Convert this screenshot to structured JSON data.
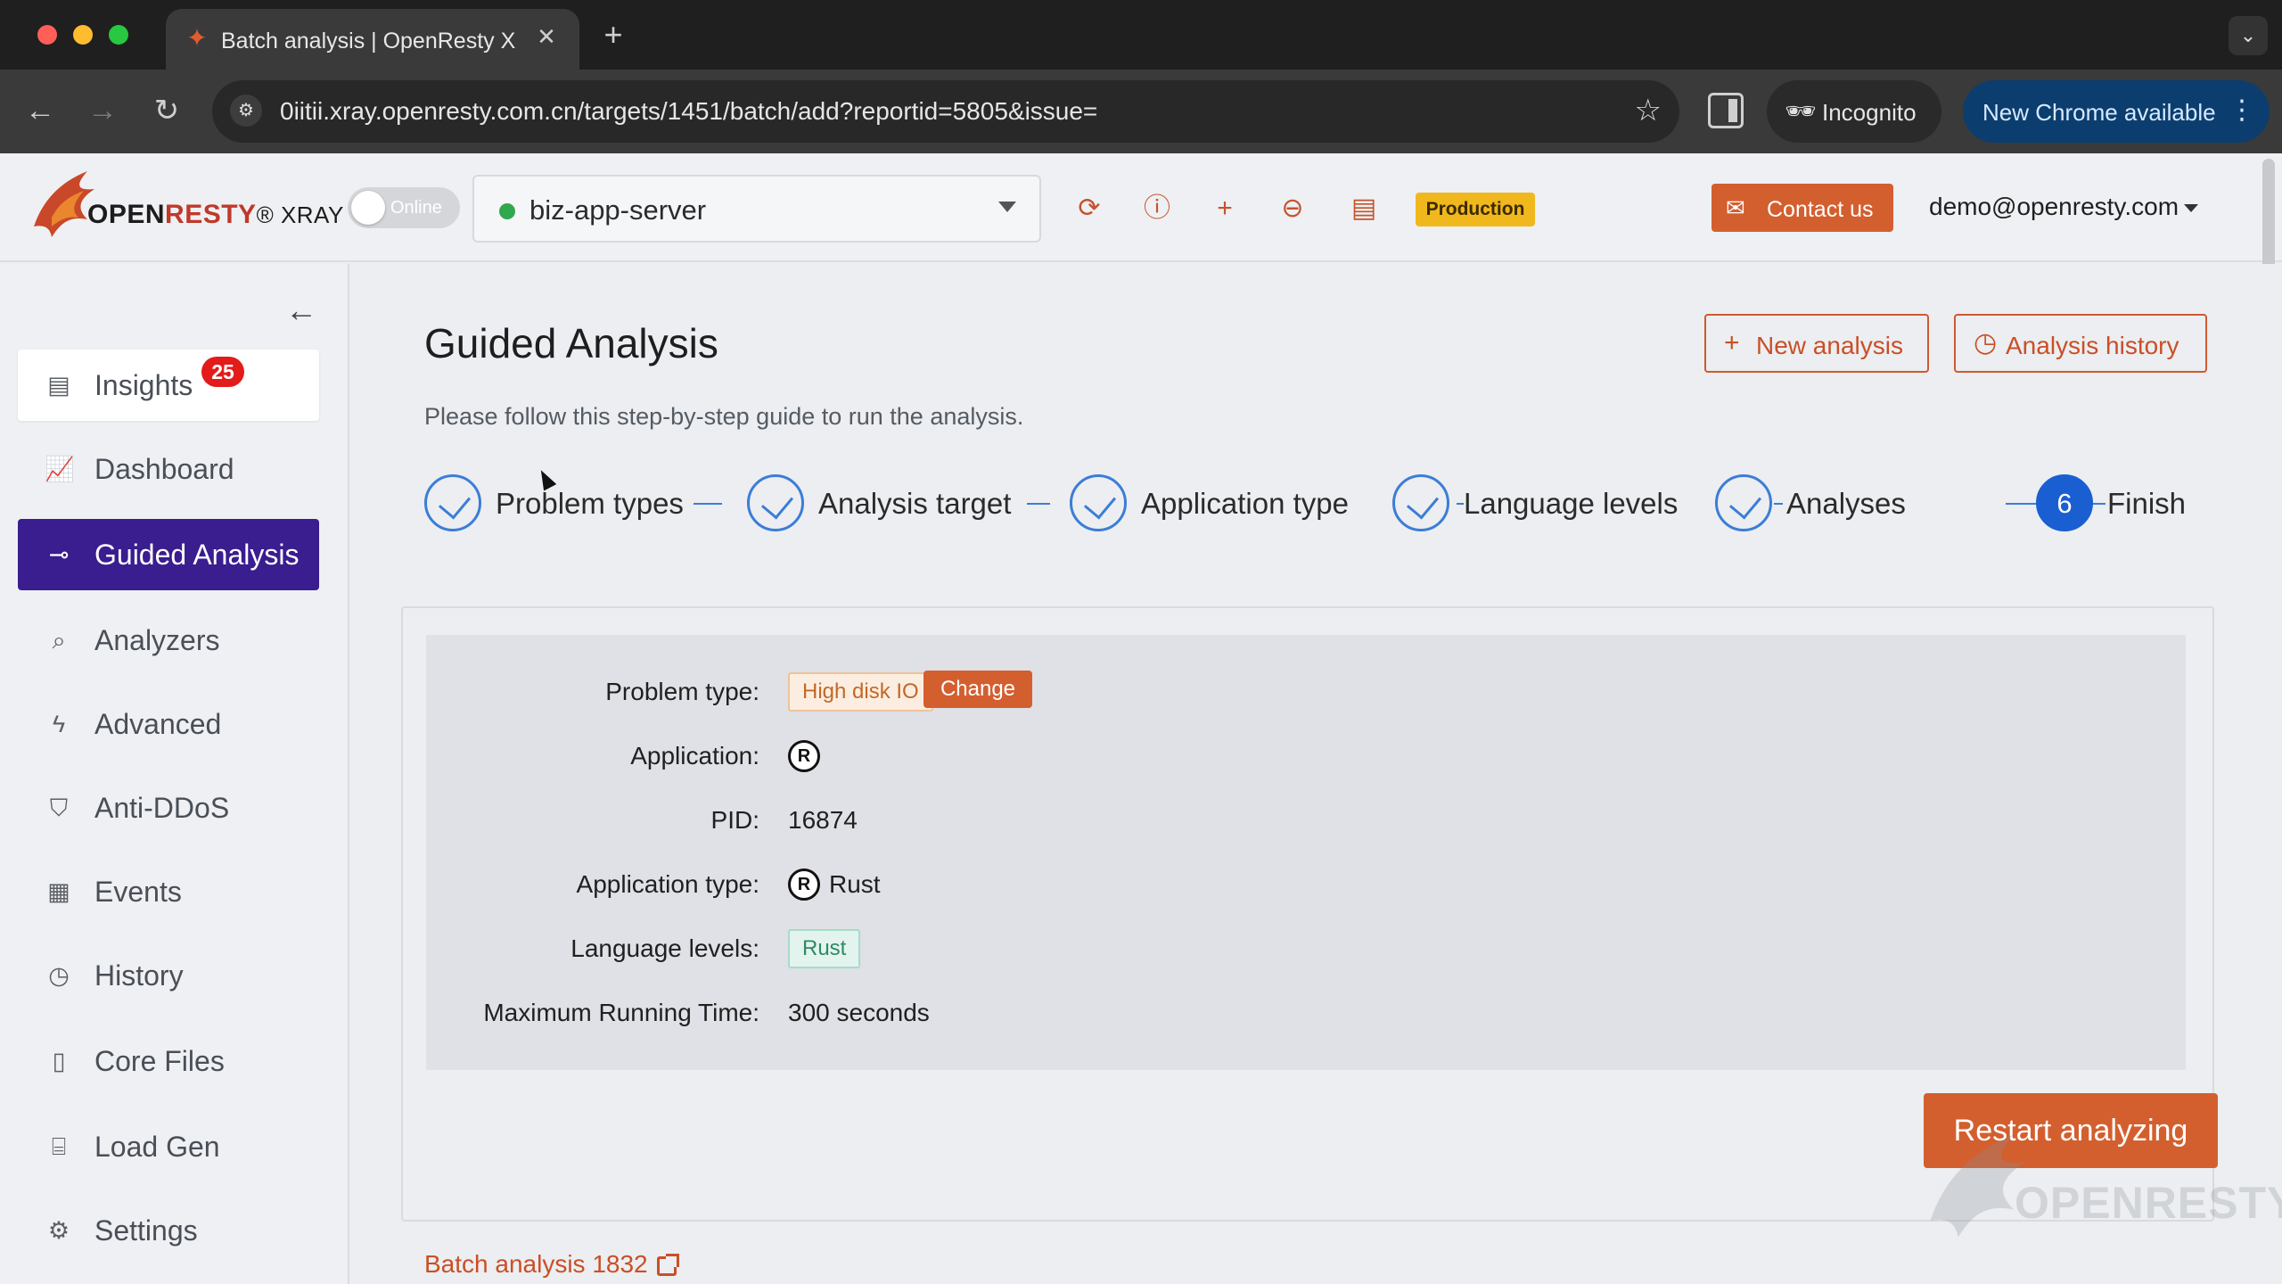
{
  "browser": {
    "tab_title": "Batch analysis | OpenResty X",
    "tab_close": "✕",
    "new_tab": "+",
    "url": "0iitii.xray.openresty.com.cn/targets/1451/batch/add?reportid=5805&issue=",
    "incognito_label": "Incognito",
    "update_label": "New Chrome available",
    "icons": {
      "back": "back-arrow-icon",
      "forward": "forward-arrow-icon",
      "reload": "reload-icon",
      "site_info": "site-settings-icon",
      "bookmark": "star-icon",
      "side_panel": "side-panel-icon",
      "incognito": "incognito-icon",
      "menu": "more-vert-icon"
    }
  },
  "header": {
    "logo_text_main": "OPEN",
    "logo_text_red": "RESTY",
    "logo_suffix": "® XRAY",
    "toggle_label": "Online",
    "server_name": "biz-app-server",
    "environment_badge": "Production",
    "contact_label": "Contact us",
    "user_email": "demo@openresty.com",
    "colors": {
      "accent": "#d35f2f",
      "badge": "#f0b81c",
      "online_dot": "#2fa84f"
    }
  },
  "sidebar": {
    "items": [
      {
        "label": "Insights",
        "icon": "document-icon",
        "badge": "25"
      },
      {
        "label": "Dashboard",
        "icon": "chart-line-icon"
      },
      {
        "label": "Guided Analysis",
        "icon": "guide-icon"
      },
      {
        "label": "Analyzers",
        "icon": "analyzer-icon"
      },
      {
        "label": "Advanced",
        "icon": "lightning-icon"
      },
      {
        "label": "Anti-DDoS",
        "icon": "shield-icon"
      },
      {
        "label": "Events",
        "icon": "calendar-icon"
      },
      {
        "label": "History",
        "icon": "clock-icon"
      },
      {
        "label": "Core Files",
        "icon": "core-file-icon"
      },
      {
        "label": "Load Gen",
        "icon": "load-gen-icon"
      },
      {
        "label": "Settings",
        "icon": "gear-icon"
      }
    ],
    "active_color": "#3a1d8f"
  },
  "main": {
    "title": "Guided Analysis",
    "subtitle": "Please follow this step-by-step guide to run the analysis.",
    "new_analysis_label": "New analysis",
    "analysis_history_label": "Analysis history",
    "steps": [
      {
        "label": "Problem types",
        "state": "done"
      },
      {
        "label": "Analysis target",
        "state": "done"
      },
      {
        "label": "Application type",
        "state": "done"
      },
      {
        "label": "Language levels",
        "state": "done"
      },
      {
        "label": "Analyses",
        "state": "done"
      },
      {
        "label": "Finish",
        "state": "current",
        "number": "6"
      }
    ],
    "summary": {
      "problem_type_label": "Problem type:",
      "problem_type_value": "High disk IO",
      "change_label": "Change",
      "application_label": "Application:",
      "pid_label": "PID:",
      "pid_value": "16874",
      "app_type_label": "Application type:",
      "app_type_value": "Rust",
      "language_levels_label": "Language levels:",
      "language_levels_value": "Rust",
      "max_time_label": "Maximum Running Time:",
      "max_time_value": "300 seconds"
    },
    "restart_label": "Restart analyzing",
    "batch_link_label": "Batch analysis 1832",
    "watermark_text": "OPENRESTY"
  }
}
